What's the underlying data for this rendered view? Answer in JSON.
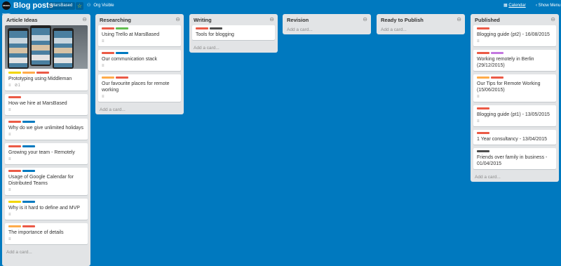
{
  "topbar": {
    "logo_text": "MARS BASED",
    "board_title": "Blog posts",
    "org_name": "MarsBased",
    "star_glyph": "☆",
    "visibility_icon": "⚇",
    "visibility_label": "Org Visible",
    "calendar_icon": "▦",
    "calendar_label": "Calendar",
    "menu_label": "‹ Show Menu"
  },
  "colors": {
    "red": "#eb5a46",
    "green": "#61bd4f",
    "blue": "#0079bf",
    "yellow": "#f2d600",
    "orange": "#ffab4a",
    "purple": "#c377e0",
    "dark": "#4d4d4d"
  },
  "lists": [
    {
      "title": "Article Ideas",
      "add_label": "Add a card...",
      "cards": [
        {
          "title": "Prototyping using Middleman",
          "labels": [
            "yellow",
            "orange",
            "red"
          ],
          "has_cover": true,
          "desc_icon": "≡",
          "attach_count": "1"
        },
        {
          "title": "How we hire at MarsBased",
          "labels": [
            "red"
          ],
          "desc_icon": "≡"
        },
        {
          "title": "Why do we give unlimited holidays",
          "labels": [
            "red",
            "blue"
          ],
          "desc_icon": "≡"
        },
        {
          "title": "Growing your team - Remotely",
          "labels": [
            "red",
            "blue"
          ],
          "desc_icon": "≡"
        },
        {
          "title": "Usage of Google Calendar for Distributed Teams",
          "labels": [
            "red",
            "blue"
          ],
          "desc_icon": "≡"
        },
        {
          "title": "Why is it hard to define and MVP",
          "labels": [
            "yellow",
            "blue"
          ],
          "desc_icon": "≡"
        },
        {
          "title": "The importance of details",
          "labels": [
            "orange",
            "red"
          ],
          "desc_icon": "≡"
        }
      ]
    },
    {
      "title": "Researching",
      "add_label": "Add a card...",
      "cards": [
        {
          "title": "Using Trello at MarsBased",
          "labels": [
            "red",
            "green"
          ],
          "desc_icon": "≡"
        },
        {
          "title": "Our communication stack",
          "labels": [
            "red",
            "blue"
          ],
          "desc_icon": "≡"
        },
        {
          "title": "Our favourite places for remote working",
          "labels": [
            "orange",
            "red"
          ],
          "desc_icon": "≡"
        }
      ]
    },
    {
      "title": "Writing",
      "add_label": "Add a card...",
      "cards": [
        {
          "title": "Tools for blogging",
          "labels": [
            "red",
            "dark"
          ]
        }
      ]
    },
    {
      "title": "Revision",
      "add_label": "Add a card...",
      "cards": []
    },
    {
      "title": "Ready to Publish",
      "add_label": "Add a card...",
      "cards": []
    },
    {
      "title": "Published",
      "add_label": "Add a card...",
      "cards": [
        {
          "title": "Blogging guide (pt2) - 16/08/2015",
          "labels": [
            "red"
          ],
          "desc_icon": "≡"
        },
        {
          "title": "Working remotely in Berlin (29/12/2015)",
          "labels": [
            "red",
            "purple"
          ]
        },
        {
          "title": "Our Tips for Remote Working (15/06/2015)",
          "labels": [
            "orange",
            "red"
          ],
          "desc_icon": "≡"
        },
        {
          "title": "Blogging guide (pt1) - 13/05/2015",
          "labels": [
            "red"
          ],
          "desc_icon": "≡"
        },
        {
          "title": "1 Year consultancy - 13/04/2015",
          "labels": [
            "red"
          ]
        },
        {
          "title": "Friends over family in business - 01/04/2015",
          "labels": [
            "dark"
          ]
        }
      ]
    }
  ],
  "list_menu_glyph": "⊖"
}
